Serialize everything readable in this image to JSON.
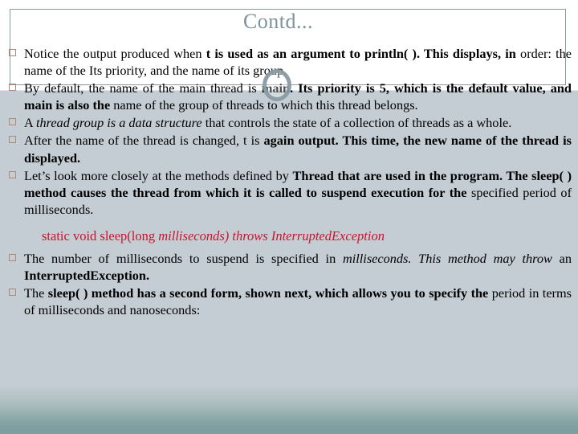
{
  "slide": {
    "title": "Contd...",
    "bullet_marker_icon": "hollow-square-bullet",
    "colors": {
      "title": "#7d939a",
      "body_background": "#c3cdd3",
      "footer_background": "#7e9fa0",
      "code_text": "#c6152e",
      "bullet_marker": "#b08878",
      "box_border": "#8a9ba3",
      "annotation_ring": "#8a9ba3"
    },
    "bullets": [
      {
        "id": "bullet-notice-output",
        "runs": [
          {
            "text": "Notice the output produced when ",
            "style": "normal"
          },
          {
            "text": "t is used as an argument to println( ). This displays, in ",
            "style": "bold"
          },
          {
            "text": "order: the name of the Its priority, and the name of its group.",
            "style": "normal"
          }
        ]
      },
      {
        "id": "bullet-by-default",
        "runs": [
          {
            "text": "By default, the name of the main thread is ",
            "style": "normal"
          },
          {
            "text": "main. Its priority is 5, which is the default value, and main is also the ",
            "style": "bold"
          },
          {
            "text": "name of the group of threads to which this thread belongs.",
            "style": "normal"
          }
        ]
      },
      {
        "id": "bullet-thread-group",
        "runs": [
          {
            "text": "A ",
            "style": "normal"
          },
          {
            "text": "thread group is a data structure ",
            "style": "italic"
          },
          {
            "text": "that controls the state of a collection of threads as a whole.",
            "style": "normal"
          }
        ]
      },
      {
        "id": "bullet-after-name-changed",
        "runs": [
          {
            "text": "After the name of the thread is changed, t is ",
            "style": "normal"
          },
          {
            "text": "again output. This time, the new name of the thread is displayed.",
            "style": "bold"
          }
        ]
      },
      {
        "id": "bullet-lets-look",
        "runs": [
          {
            "text": "Let’s look more closely at the methods defined by ",
            "style": "normal"
          },
          {
            "text": "Thread that are used in the program. The ",
            "style": "bold"
          },
          {
            "text": "sleep( ) method causes the thread from which it is called to suspend execution for the ",
            "style": "bold"
          },
          {
            "text": "specified period of milliseconds.",
            "style": "normal"
          }
        ]
      }
    ],
    "code_line": {
      "id": "sleep-signature",
      "runs": [
        {
          "text": "static void sleep(long ",
          "style": "normal"
        },
        {
          "text": "milliseconds) throws InterruptedException",
          "style": "italic"
        }
      ]
    },
    "bullets_after_code": [
      {
        "id": "bullet-number-of-ms",
        "runs": [
          {
            "text": "The number of milliseconds to suspend is specified in ",
            "style": "normal"
          },
          {
            "text": "milliseconds. This method may throw ",
            "style": "italic"
          },
          {
            "text": "an ",
            "style": "normal"
          },
          {
            "text": "InterruptedException.",
            "style": "bold"
          }
        ]
      },
      {
        "id": "bullet-sleep-second-form",
        "runs": [
          {
            "text": "The ",
            "style": "normal"
          },
          {
            "text": "sleep( ) method has a second form, shown next, which allows you to specify the ",
            "style": "bold"
          },
          {
            "text": "period in terms of milliseconds and nanoseconds:",
            "style": "normal"
          }
        ]
      }
    ]
  }
}
